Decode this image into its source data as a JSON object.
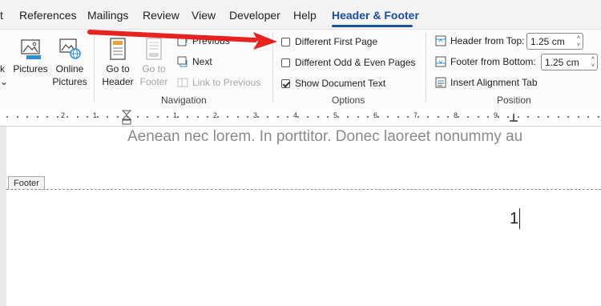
{
  "tabs": [
    "t",
    "References",
    "Mailings",
    "Review",
    "View",
    "Developer",
    "Help",
    "Header & Footer"
  ],
  "ribbon": {
    "insert": {
      "partial_label_1": "k",
      "partial_label_2": "⌄",
      "pictures": "Pictures",
      "online_pictures_1": "Online",
      "online_pictures_2": "Pictures"
    },
    "navigation": {
      "goto_header_1": "Go to",
      "goto_header_2": "Header",
      "goto_footer_1": "Go to",
      "goto_footer_2": "Footer",
      "previous": "Previous",
      "next": "Next",
      "link_to_previous": "Link to Previous",
      "group_label": "Navigation"
    },
    "options": {
      "different_first_page": "Different First Page",
      "different_odd_even": "Different Odd & Even Pages",
      "show_document_text": "Show Document Text",
      "different_first_page_checked": false,
      "different_odd_even_checked": false,
      "show_document_text_checked": true,
      "group_label": "Options"
    },
    "position": {
      "header_from_top_label": "Header from Top:",
      "header_from_top_value": "1.25 cm",
      "footer_from_bottom_label": "Footer from Bottom:",
      "footer_from_bottom_value": "1.25 cm",
      "insert_alignment_tab": "Insert Alignment Tab",
      "group_label": "Position"
    }
  },
  "ruler": {
    "numbers": [
      "2",
      "1",
      "1",
      "2",
      "3",
      "4",
      "5",
      "6",
      "7",
      "8",
      "9"
    ]
  },
  "document": {
    "body_text": "Aenean nec lorem. In porttitor. Donec laoreet nonummy au",
    "footer_label": "Footer",
    "page_number": "1"
  },
  "colors": {
    "accent": "#1b4fa3",
    "arrow": "#e8231f"
  }
}
